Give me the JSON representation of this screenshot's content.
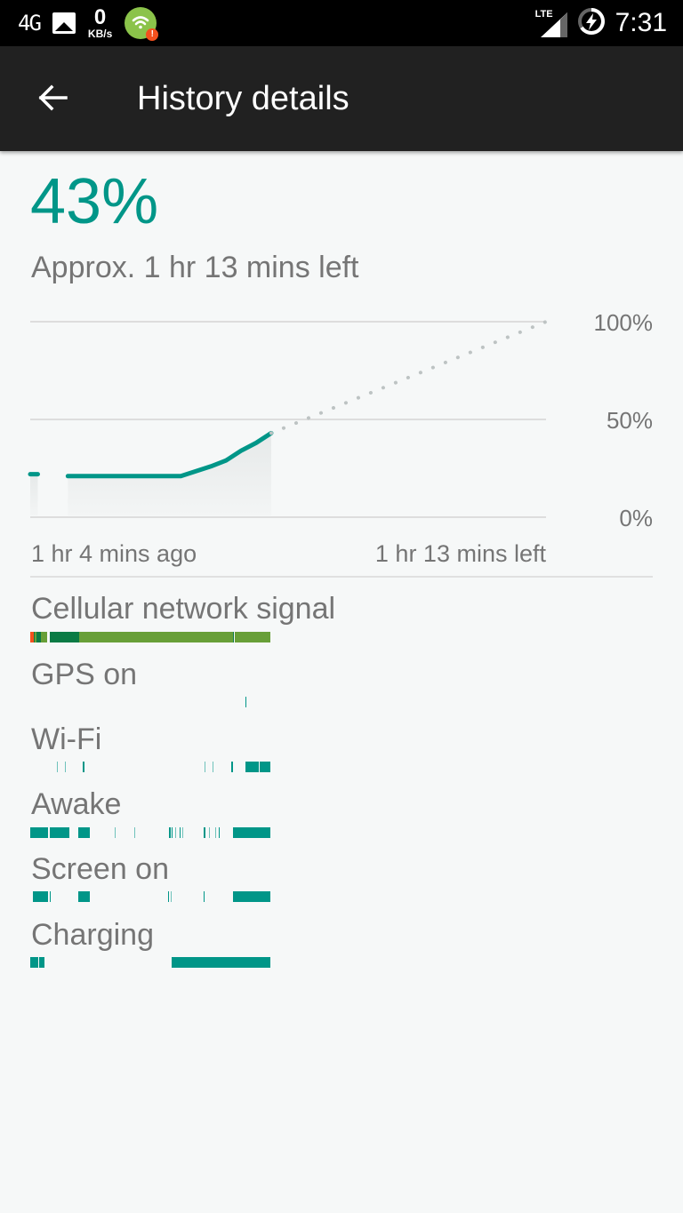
{
  "status_bar": {
    "network_type": "4G",
    "speed_value": "0",
    "speed_unit": "KB/s",
    "wifi_alert": "!",
    "lte_label": "LTE",
    "time": "7:31",
    "icons": [
      "4g-icon",
      "image-notification-icon",
      "network-speed-icon",
      "wifi-alert-app-icon",
      "lte-signal-icon",
      "battery-charging-icon"
    ]
  },
  "app_bar": {
    "title": "History details",
    "back_icon": "arrow-back-icon"
  },
  "battery": {
    "percent": "43%",
    "estimate": "Approx. 1 hr 13 mins left"
  },
  "colors": {
    "accent": "#009688",
    "cell_poor": "#f4511e",
    "cell_moderate": "#0b7b45",
    "cell_good": "#689f38",
    "prediction": "#bdc3c3",
    "grid": "#dddddd"
  },
  "chart_data": {
    "type": "line",
    "title": "",
    "xlabel": "",
    "ylabel": "",
    "ylim": [
      0,
      100
    ],
    "yticks": [
      "100%",
      "50%",
      "0%"
    ],
    "x_start_label": "1 hr 4 mins ago",
    "x_end_label": "1 hr 13 mins left",
    "xlim_minutes": [
      -64,
      73
    ],
    "series": [
      {
        "name": "battery-history",
        "style": "solid",
        "x": [
          -64,
          -62
        ],
        "y": [
          22,
          22
        ]
      },
      {
        "name": "battery-history",
        "style": "solid",
        "x": [
          -54,
          -48,
          -40,
          -32,
          -24,
          -16,
          -12,
          -8,
          -4,
          0
        ],
        "y": [
          21,
          21,
          21,
          21,
          21,
          26,
          29,
          34,
          38,
          43
        ]
      },
      {
        "name": "prediction",
        "style": "dotted",
        "x": [
          0,
          73
        ],
        "y": [
          43,
          100
        ]
      }
    ]
  },
  "history_rows": [
    {
      "label": "Cellular network signal",
      "segments": [
        {
          "start": 0.0,
          "end": 0.013,
          "level": "poor"
        },
        {
          "start": 0.013,
          "end": 0.02,
          "level": "moderate"
        },
        {
          "start": 0.02,
          "end": 0.026,
          "level": "good"
        },
        {
          "start": 0.026,
          "end": 0.044,
          "level": "moderate"
        },
        {
          "start": 0.044,
          "end": 0.07,
          "level": "good"
        },
        {
          "start": 0.081,
          "end": 0.204,
          "level": "moderate"
        },
        {
          "start": 0.204,
          "end": 0.844,
          "level": "good"
        },
        {
          "start": 0.844,
          "end": 0.85,
          "level": "moderate"
        },
        {
          "start": 0.85,
          "end": 1.0,
          "level": "good"
        }
      ]
    },
    {
      "label": "GPS on",
      "segments": [
        {
          "start": 0.896,
          "end": 0.9
        }
      ]
    },
    {
      "label": "Wi-Fi",
      "segments": [
        {
          "start": 0.111,
          "end": 0.115,
          "weak": true
        },
        {
          "start": 0.144,
          "end": 0.148,
          "weak": true
        },
        {
          "start": 0.219,
          "end": 0.226
        },
        {
          "start": 0.726,
          "end": 0.73,
          "weak": true
        },
        {
          "start": 0.759,
          "end": 0.763,
          "weak": true
        },
        {
          "start": 0.837,
          "end": 0.844
        },
        {
          "start": 0.896,
          "end": 0.952
        },
        {
          "start": 0.956,
          "end": 1.0
        }
      ]
    },
    {
      "label": "Awake",
      "segments": [
        {
          "start": 0.0,
          "end": 0.074
        },
        {
          "start": 0.081,
          "end": 0.163
        },
        {
          "start": 0.2,
          "end": 0.248
        },
        {
          "start": 0.352,
          "end": 0.356,
          "weak": true
        },
        {
          "start": 0.433,
          "end": 0.437,
          "weak": true
        },
        {
          "start": 0.578,
          "end": 0.585
        },
        {
          "start": 0.589,
          "end": 0.593
        },
        {
          "start": 0.604,
          "end": 0.607,
          "weak": true
        },
        {
          "start": 0.622,
          "end": 0.626
        },
        {
          "start": 0.633,
          "end": 0.637,
          "weak": true
        },
        {
          "start": 0.722,
          "end": 0.73
        },
        {
          "start": 0.744,
          "end": 0.748,
          "weak": true
        },
        {
          "start": 0.77,
          "end": 0.774,
          "weak": true
        },
        {
          "start": 0.785,
          "end": 0.789
        },
        {
          "start": 0.844,
          "end": 1.0
        }
      ]
    },
    {
      "label": "Screen on",
      "segments": [
        {
          "start": 0.011,
          "end": 0.074
        },
        {
          "start": 0.081,
          "end": 0.085
        },
        {
          "start": 0.2,
          "end": 0.248
        },
        {
          "start": 0.574,
          "end": 0.578
        },
        {
          "start": 0.585,
          "end": 0.589,
          "weak": true
        },
        {
          "start": 0.722,
          "end": 0.726
        },
        {
          "start": 0.844,
          "end": 1.0
        }
      ]
    },
    {
      "label": "Charging",
      "segments": [
        {
          "start": 0.0,
          "end": 0.033
        },
        {
          "start": 0.037,
          "end": 0.059
        },
        {
          "start": 0.589,
          "end": 1.0
        }
      ]
    }
  ]
}
